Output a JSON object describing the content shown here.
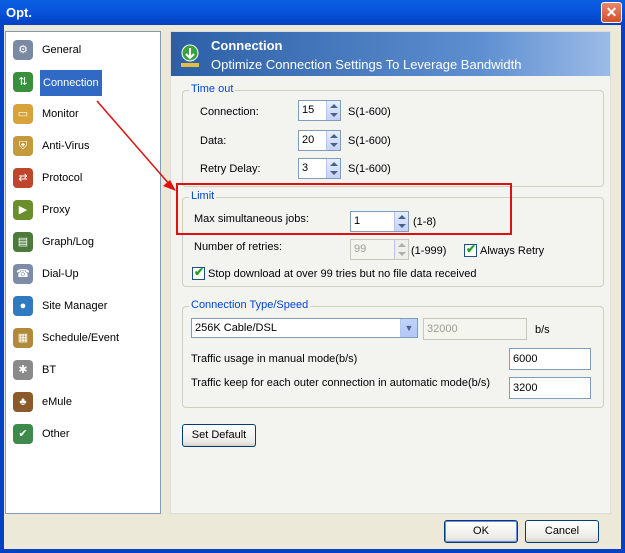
{
  "window": {
    "title": "Opt.",
    "close_label": "✕"
  },
  "sidebar": {
    "items": [
      {
        "label": "General",
        "icon": "general-icon",
        "color": "#7b8aa3"
      },
      {
        "label": "Connection",
        "icon": "connection-icon",
        "color": "#3a8f3a",
        "active": true
      },
      {
        "label": "Monitor",
        "icon": "monitor-icon",
        "color": "#d8a33a"
      },
      {
        "label": "Anti-Virus",
        "icon": "antivirus-icon",
        "color": "#c59a3d"
      },
      {
        "label": "Protocol",
        "icon": "protocol-icon",
        "color": "#c0452d"
      },
      {
        "label": "Proxy",
        "icon": "proxy-icon",
        "color": "#6a8f2a"
      },
      {
        "label": "Graph/Log",
        "icon": "graph-icon",
        "color": "#4b7a3a"
      },
      {
        "label": "Dial-Up",
        "icon": "dialup-icon",
        "color": "#7d8da8"
      },
      {
        "label": "Site Manager",
        "icon": "site-manager-icon",
        "color": "#2f7ac0"
      },
      {
        "label": "Schedule/Event",
        "icon": "schedule-icon",
        "color": "#b08a3a"
      },
      {
        "label": "BT",
        "icon": "bt-icon",
        "color": "#8a8a8a"
      },
      {
        "label": "eMule",
        "icon": "emule-icon",
        "color": "#8a5a2a"
      },
      {
        "label": "Other",
        "icon": "other-icon",
        "color": "#3d8a4a"
      }
    ]
  },
  "header": {
    "title": "Connection",
    "subtitle": "Optimize Connection Settings To Leverage Bandwidth"
  },
  "timeout": {
    "legend": "Time out",
    "connection_label": "Connection:",
    "connection_value": "15",
    "data_label": "Data:",
    "data_value": "20",
    "retry_label": "Retry Delay:",
    "retry_value": "3",
    "unit": "S(1-600)"
  },
  "limit": {
    "legend": "Limit",
    "max_jobs_label": "Max simultaneous jobs:",
    "max_jobs_value": "1",
    "max_jobs_range": "(1-8)",
    "retries_label": "Number of retries:",
    "retries_value": "99",
    "retries_range": "(1-999)",
    "always_retry_label": "Always Retry",
    "always_retry_checked": true,
    "stop_label": "Stop download at over 99 tries but no file data received",
    "stop_checked": true
  },
  "conntype": {
    "legend": "Connection Type/Speed",
    "type_value": "256K Cable/DSL",
    "speed_value": "32000",
    "speed_unit": "b/s",
    "manual_label": "Traffic usage in manual mode(b/s)",
    "manual_value": "6000",
    "auto_label": "Traffic keep for each outer connection in automatic mode(b/s)",
    "auto_value": "3200"
  },
  "buttons": {
    "set_default": "Set Default",
    "ok": "OK",
    "cancel": "Cancel"
  },
  "annotation": {
    "color": "#e01010"
  }
}
